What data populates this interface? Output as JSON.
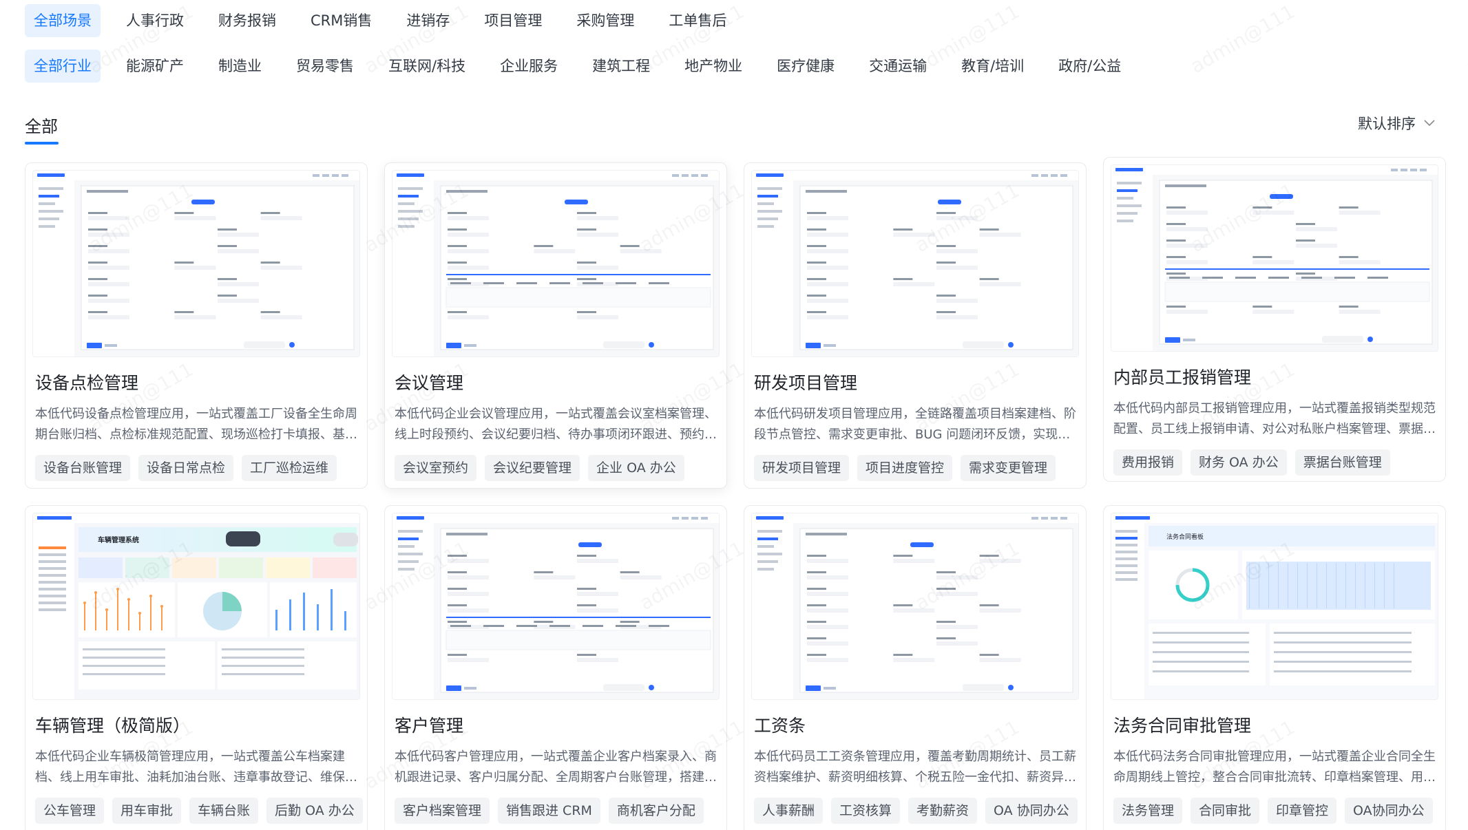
{
  "scene_filters": [
    {
      "label": "全部场景",
      "active": true
    },
    {
      "label": "人事行政",
      "active": false
    },
    {
      "label": "财务报销",
      "active": false
    },
    {
      "label": "CRM销售",
      "active": false
    },
    {
      "label": "进销存",
      "active": false
    },
    {
      "label": "项目管理",
      "active": false
    },
    {
      "label": "采购管理",
      "active": false
    },
    {
      "label": "工单售后",
      "active": false
    }
  ],
  "industry_filters": [
    {
      "label": "全部行业",
      "active": true
    },
    {
      "label": "能源矿产",
      "active": false
    },
    {
      "label": "制造业",
      "active": false
    },
    {
      "label": "贸易零售",
      "active": false
    },
    {
      "label": "互联网/科技",
      "active": false
    },
    {
      "label": "企业服务",
      "active": false
    },
    {
      "label": "建筑工程",
      "active": false
    },
    {
      "label": "地产物业",
      "active": false
    },
    {
      "label": "医疗健康",
      "active": false
    },
    {
      "label": "交通运输",
      "active": false
    },
    {
      "label": "教育/培训",
      "active": false
    },
    {
      "label": "政府/公益",
      "active": false
    }
  ],
  "section": {
    "title": "全部",
    "sort_label": "默认排序"
  },
  "watermark_text": "admin@111",
  "cards": [
    {
      "title": "设备点检管理",
      "desc": "本低代码设备点检管理应用，一站式覆盖工厂设备全生命周期台账归档、点检标准规范配置、现场巡检打卡填报、基…",
      "tags": [
        "设备台账管理",
        "设备日常点检",
        "工厂巡检运维"
      ],
      "thumb": "form"
    },
    {
      "title": "会议管理",
      "desc": "本低代码企业会议管理应用，一站式覆盖会议室档案管理、线上时段预约、会议纪要归档、待办事项闭环跟进、预约…",
      "tags": [
        "会议室预约",
        "会议纪要管理",
        "企业 OA 办公"
      ],
      "thumb": "form"
    },
    {
      "title": "研发项目管理",
      "desc": "本低代码研发项目管理应用，全链路覆盖项目档案建档、阶段节点管控、需求变更审批、BUG 问题闭环反馈，实现…",
      "tags": [
        "研发项目管理",
        "项目进度管控",
        "需求变更管理"
      ],
      "thumb": "form"
    },
    {
      "title": "内部员工报销管理",
      "desc": "本低代码内部员工报销管理应用，一站式覆盖报销类型规范配置、员工线上报销申请、对公对私账户档案管理、票据…",
      "tags": [
        "费用报销",
        "财务 OA 办公",
        "票据台账管理"
      ],
      "thumb": "form"
    },
    {
      "title": "车辆管理（极简版）",
      "desc": "本低代码企业车辆极简管理应用，一站式覆盖公车档案建档、线上用车审批、油耗加油台账、违章事故登记、维保…",
      "tags": [
        "公车管理",
        "用车审批",
        "车辆台账",
        "后勤 OA 办公"
      ],
      "thumb": "dashboard",
      "banner": "车辆管理系统"
    },
    {
      "title": "客户管理",
      "desc": "本低代码客户管理应用，一站式覆盖企业客户档案录入、商机跟进记录、客户归属分配、全周期客户台账管理，搭建…",
      "tags": [
        "客户档案管理",
        "销售跟进 CRM",
        "商机客户分配"
      ],
      "thumb": "form"
    },
    {
      "title": "工资条",
      "desc": "本低代码员工工资条管理应用，覆盖考勤周期统计、员工薪资档案维护、薪资明细核算、个税五险一金代扣、薪资异…",
      "tags": [
        "人事薪酬",
        "工资核算",
        "考勤薪资",
        "OA 协同办公"
      ],
      "thumb": "form"
    },
    {
      "title": "法务合同审批管理",
      "desc": "本低代码法务合同审批管理应用，一站式覆盖企业合同全生命周期线上管控，整合合同审批流转、印章档案管理、用…",
      "tags": [
        "法务管理",
        "合同审批",
        "印章管控",
        "OA协同办公"
      ],
      "thumb": "analytics",
      "banner": "法务合同看板"
    }
  ]
}
